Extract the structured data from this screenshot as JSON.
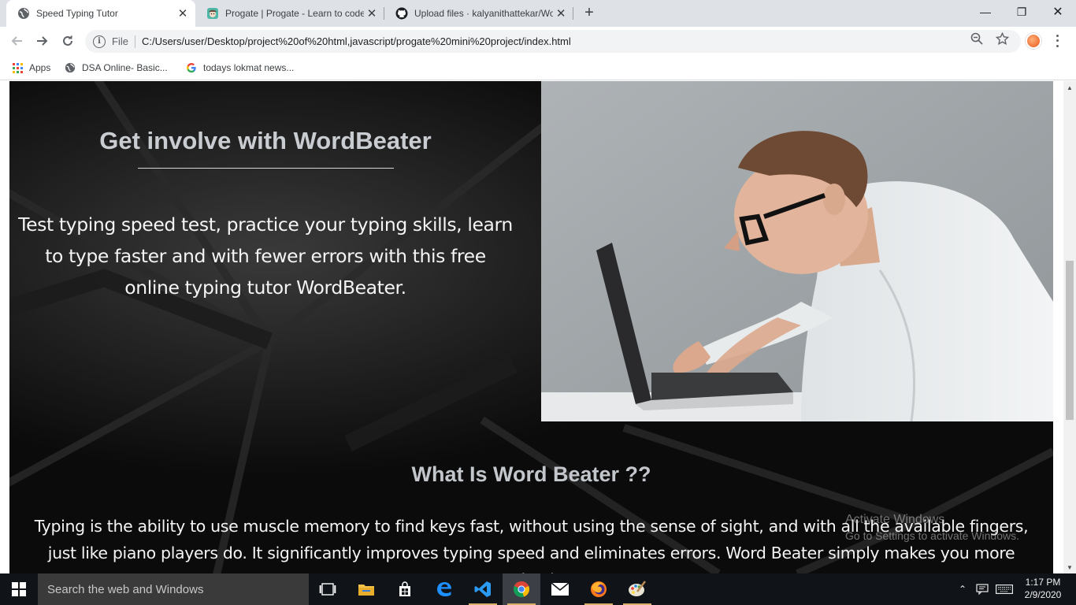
{
  "browser": {
    "tabs": [
      {
        "title": "Speed Typing Tutor",
        "active": true
      },
      {
        "title": "Progate | Progate - Learn to code",
        "active": false
      },
      {
        "title": "Upload files · kalyanithattekar/Wo",
        "active": false
      }
    ],
    "new_tab": "+",
    "close_glyph": "✕",
    "window_controls": {
      "minimize": "—",
      "restore": "❐",
      "close": "✕"
    },
    "address": {
      "scheme": "File",
      "url": "C:/Users/user/Desktop/project%20of%20html,javascript/progate%20mini%20project/index.html"
    },
    "bookmarks": [
      {
        "label": "Apps",
        "icon": "apps-grid-icon"
      },
      {
        "label": "DSA Online- Basic...",
        "icon": "globe-icon"
      },
      {
        "label": "todays lokmat news...",
        "icon": "google-icon"
      }
    ]
  },
  "page": {
    "involve_heading": "Get involve with WordBeater",
    "intro_text": "Test typing speed test, practice your typing skills, learn to type faster and with fewer errors with this free online typing tutor WordBeater.",
    "what_heading": "What Is Word Beater ??",
    "what_paragraph": "Typing is the ability to use muscle memory to find keys fast, without using the sense of sight, and with all the available fingers, just like piano players do. It significantly improves typing speed and eliminates errors. Word Beater simply makes you more productive"
  },
  "watermark": {
    "line1": "Activate Windows",
    "line2": "Go to Settings to activate Windows."
  },
  "taskbar": {
    "search_placeholder": "Search the web and Windows",
    "time": "1:17 PM",
    "date": "2/9/2020"
  },
  "colors": {
    "page_bg": "#0b0b0b",
    "heading_grey": "#c9ccd1",
    "body_text": "#f4f4f4",
    "taskbar_bg": "#101418"
  }
}
